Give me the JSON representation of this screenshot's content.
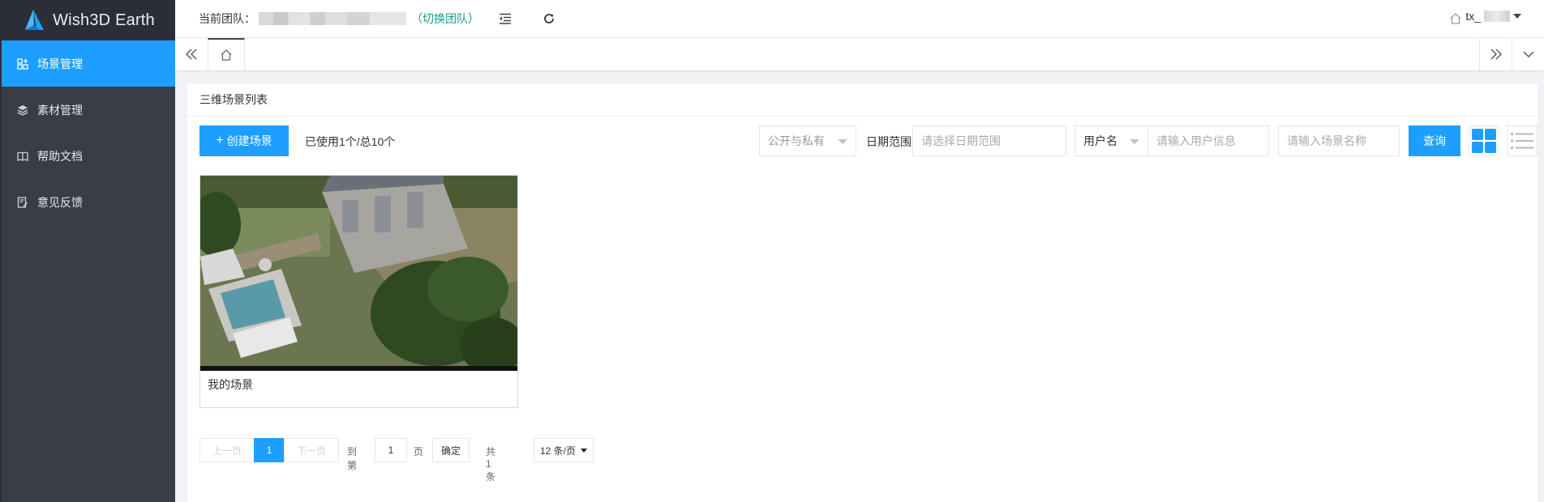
{
  "app": {
    "logo_text": "Wish3D Earth"
  },
  "sidebar": {
    "items": [
      {
        "label": "场景管理",
        "icon": "scene-grid-icon",
        "active": true
      },
      {
        "label": "素材管理",
        "icon": "layers-icon",
        "active": false
      },
      {
        "label": "帮助文档",
        "icon": "book-icon",
        "active": false
      },
      {
        "label": "意见反馈",
        "icon": "feedback-icon",
        "active": false
      }
    ]
  },
  "header": {
    "team_label": "当前团队：",
    "switch_team": "（切换团队）",
    "user_name_prefix": "tx_"
  },
  "page": {
    "card_title": "三维场景列表",
    "create_label": "创建场景",
    "used_info": "已使用1个/总10个",
    "visibility_select": "公开与私有",
    "date_label": "日期范围",
    "date_placeholder": "请选择日期范围",
    "user_field_select": "用户名",
    "user_placeholder": "请输入用户信息",
    "scene_placeholder": "请输入场景名称",
    "query_label": "查询"
  },
  "scenes": [
    {
      "name": "我的场景"
    }
  ],
  "pagination": {
    "prev": "上一页",
    "current": "1",
    "next": "下一页",
    "goto": "到第",
    "page_value": "1",
    "page_unit": "页",
    "confirm": "确定",
    "total": "共 1 条",
    "page_size": "12 条/页"
  },
  "colors": {
    "accent": "#1e9fff",
    "sidebar_bg": "#3a3d47",
    "switch_team": "#16a085"
  }
}
